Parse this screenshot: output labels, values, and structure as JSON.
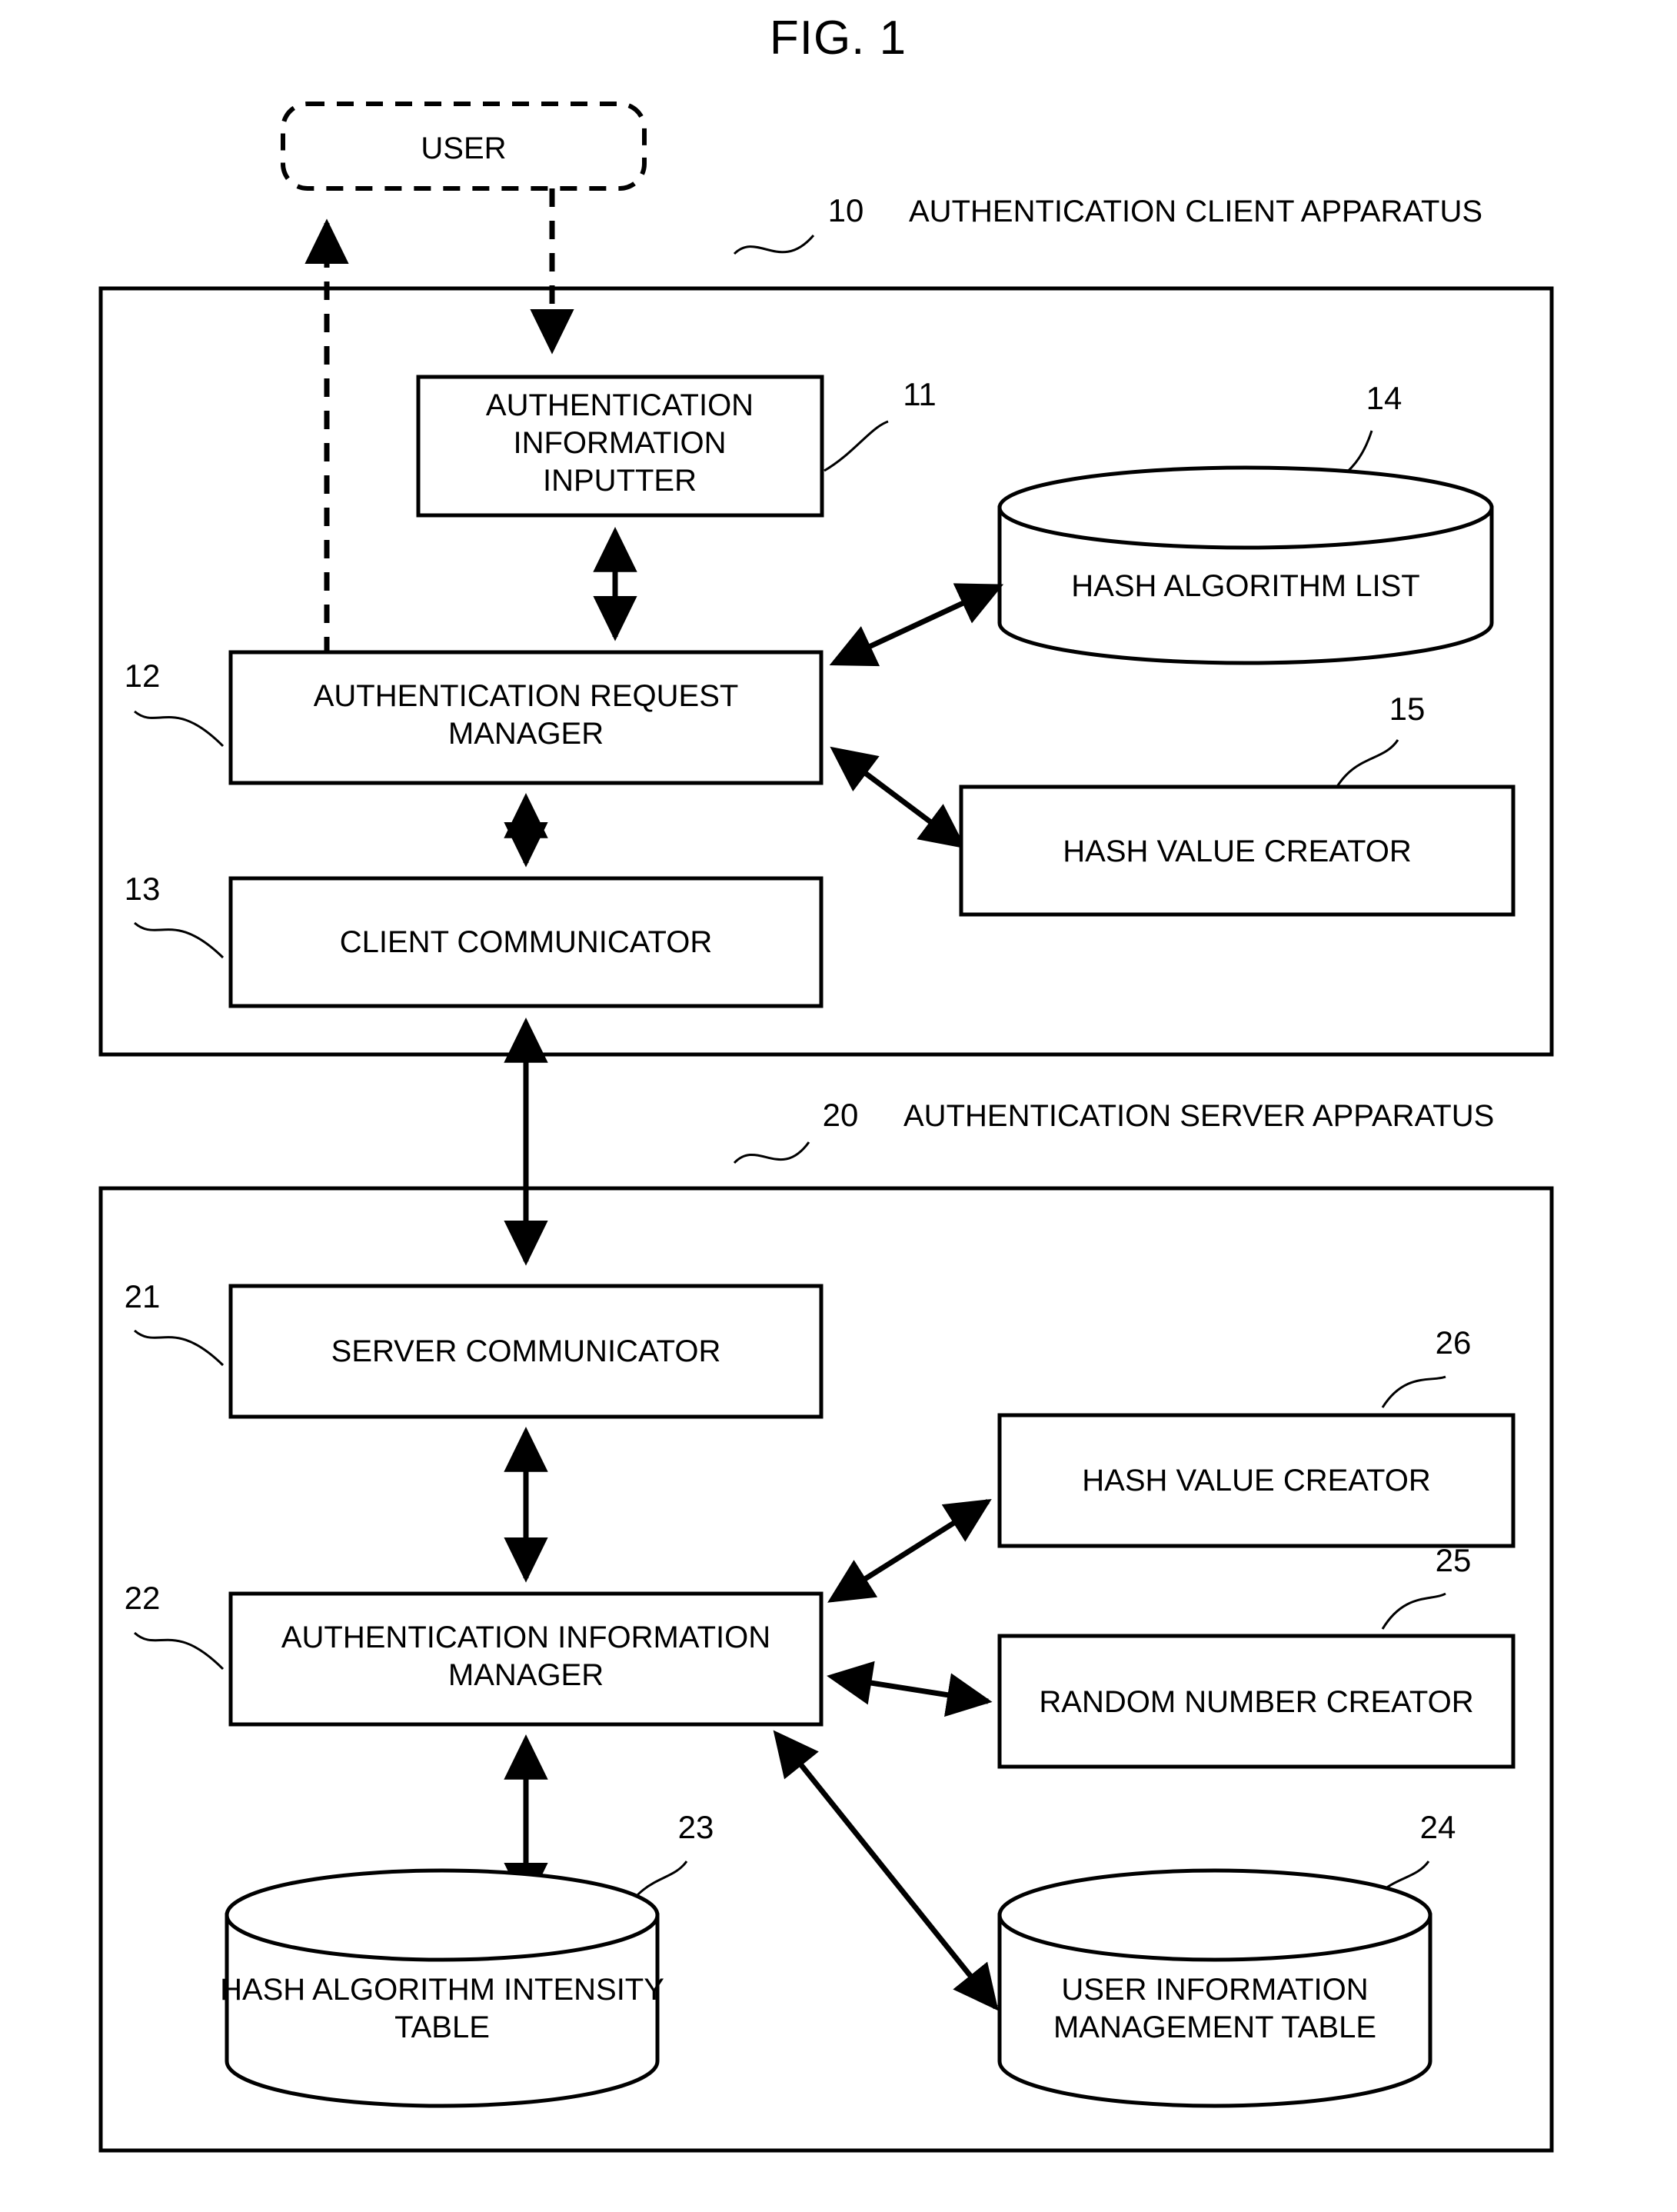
{
  "figure": {
    "title": "FIG. 1",
    "type": "patent-block-diagram"
  },
  "actor": {
    "label": "USER"
  },
  "client_apparatus": {
    "ref": "10",
    "label": "AUTHENTICATION CLIENT APPARATUS",
    "components": [
      {
        "ref": "11",
        "label_line1": "AUTHENTICATION",
        "label_line2": "INFORMATION",
        "label_line3": "INPUTTER",
        "shape": "rectangle"
      },
      {
        "ref": "12",
        "label_line1": "AUTHENTICATION REQUEST",
        "label_line2": "MANAGER",
        "shape": "rectangle"
      },
      {
        "ref": "13",
        "label_line1": "CLIENT COMMUNICATOR",
        "shape": "rectangle"
      },
      {
        "ref": "14",
        "label_line1": "HASH ALGORITHM LIST",
        "shape": "cylinder"
      },
      {
        "ref": "15",
        "label_line1": "HASH VALUE CREATOR",
        "shape": "rectangle"
      }
    ]
  },
  "server_apparatus": {
    "ref": "20",
    "label": "AUTHENTICATION SERVER APPARATUS",
    "components": [
      {
        "ref": "21",
        "label_line1": "SERVER COMMUNICATOR",
        "shape": "rectangle"
      },
      {
        "ref": "22",
        "label_line1": "AUTHENTICATION INFORMATION",
        "label_line2": "MANAGER",
        "shape": "rectangle"
      },
      {
        "ref": "23",
        "label_line1": "HASH ALGORITHM INTENSITY",
        "label_line2": "TABLE",
        "shape": "cylinder"
      },
      {
        "ref": "24",
        "label_line1": "USER INFORMATION",
        "label_line2": "MANAGEMENT TABLE",
        "shape": "cylinder"
      },
      {
        "ref": "25",
        "label_line1": "RANDOM NUMBER CREATOR",
        "shape": "rectangle"
      },
      {
        "ref": "26",
        "label_line1": "HASH VALUE CREATOR",
        "shape": "rectangle"
      }
    ]
  },
  "connections": [
    {
      "from": "USER",
      "to": "AUTHENTICATION INFORMATION INPUTTER",
      "style": "dashed",
      "arrows": "one-way"
    },
    {
      "from": "AUTHENTICATION REQUEST MANAGER",
      "to": "USER",
      "style": "dashed",
      "arrows": "one-way"
    },
    {
      "from": "AUTHENTICATION INFORMATION INPUTTER",
      "to": "AUTHENTICATION REQUEST MANAGER",
      "style": "solid",
      "arrows": "two-way"
    },
    {
      "from": "AUTHENTICATION REQUEST MANAGER",
      "to": "HASH ALGORITHM LIST",
      "style": "solid",
      "arrows": "two-way"
    },
    {
      "from": "AUTHENTICATION REQUEST MANAGER",
      "to": "HASH VALUE CREATOR",
      "style": "solid",
      "arrows": "two-way"
    },
    {
      "from": "AUTHENTICATION REQUEST MANAGER",
      "to": "CLIENT COMMUNICATOR",
      "style": "solid",
      "arrows": "two-way"
    },
    {
      "from": "CLIENT COMMUNICATOR",
      "to": "SERVER COMMUNICATOR",
      "style": "solid",
      "arrows": "two-way"
    },
    {
      "from": "SERVER COMMUNICATOR",
      "to": "AUTHENTICATION INFORMATION MANAGER",
      "style": "solid",
      "arrows": "two-way"
    },
    {
      "from": "AUTHENTICATION INFORMATION MANAGER",
      "to": "HASH VALUE CREATOR",
      "style": "solid",
      "arrows": "two-way"
    },
    {
      "from": "AUTHENTICATION INFORMATION MANAGER",
      "to": "RANDOM NUMBER CREATOR",
      "style": "solid",
      "arrows": "two-way"
    },
    {
      "from": "AUTHENTICATION INFORMATION MANAGER",
      "to": "HASH ALGORITHM INTENSITY TABLE",
      "style": "solid",
      "arrows": "two-way"
    },
    {
      "from": "AUTHENTICATION INFORMATION MANAGER",
      "to": "USER INFORMATION MANAGEMENT TABLE",
      "style": "solid",
      "arrows": "two-way"
    }
  ]
}
